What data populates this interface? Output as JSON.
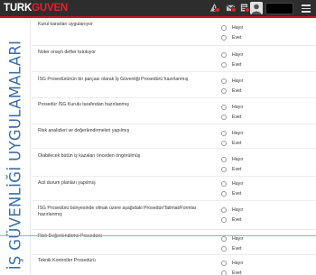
{
  "header": {
    "brand_part1": "TURK",
    "brand_part2": "GUVEN",
    "notifications": [
      {
        "icon": "alert-icon"
      },
      {
        "icon": "mail-icon"
      },
      {
        "icon": "tasks-icon"
      }
    ],
    "user_name": "",
    "colors": {
      "topbar": "#2d2d2d",
      "accent": "#e5222b"
    }
  },
  "sidebar": {
    "title": "İŞ GÜVENLİĞİ UYGULAMALARI"
  },
  "options": {
    "no": "Hayır",
    "yes": "Evet"
  },
  "questions": [
    {
      "text": "Kurul kararları uygulanıyor"
    },
    {
      "text": "Noter onaylı defter tutuluyor"
    },
    {
      "text": "İSG Prosedürünün bir parçası olarak İş Güvenliği Prosedürü hazırlanmış"
    },
    {
      "text": "Prosedür İSG Kurulu tarafından hazırlanmış"
    },
    {
      "text": "Risk analizleri ve değerlendirmeleri yapılmış"
    },
    {
      "text": "Olabilecek bütün iş kazaları önceden öngörülmüş"
    },
    {
      "text": "Acil durum planları yapılmış"
    },
    {
      "text": "İSG Prosedürü bünyesinde olmak üzere aşağıdaki Prosedür/Talimat/Formlar hazırlanmış"
    },
    {
      "text": "Risk Değerlendirme Prosedürü"
    },
    {
      "text": "Teknik Kontroller Prosedürü"
    }
  ]
}
